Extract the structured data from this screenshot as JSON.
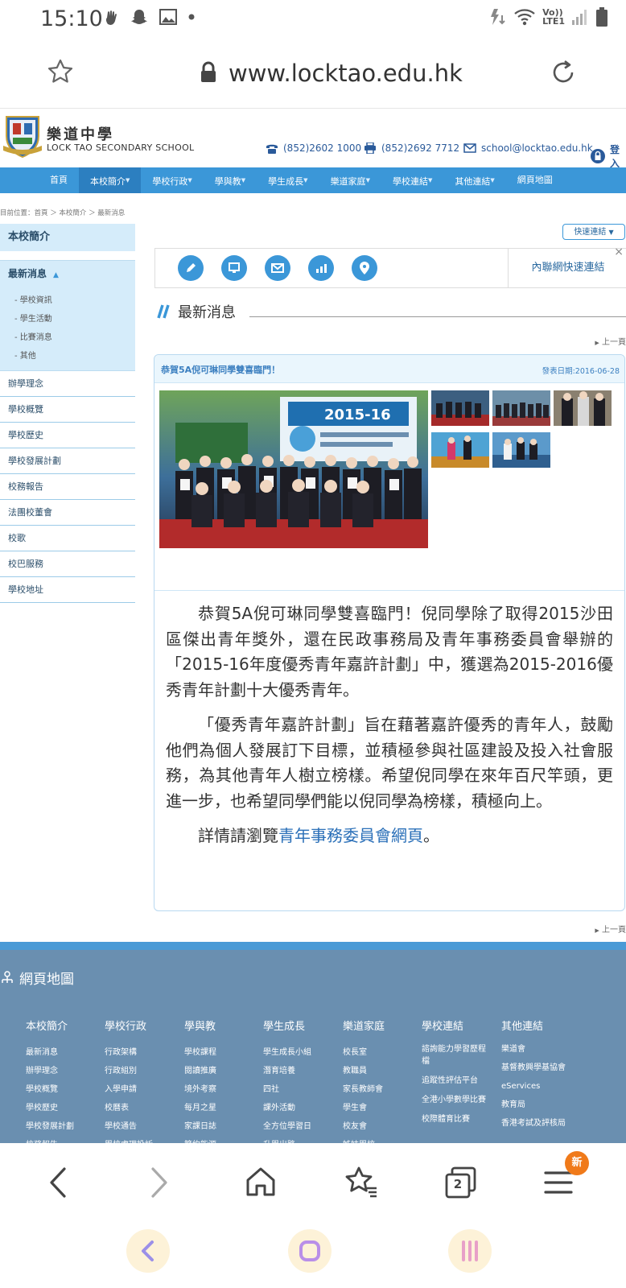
{
  "status": {
    "time": "15:10",
    "network": "LTE1",
    "volte": "Vo))"
  },
  "browser": {
    "url": "www.locktao.edu.hk"
  },
  "school": {
    "name_cn": "樂道中學",
    "name_en": "LOCK TAO SECONDARY SCHOOL",
    "phone": "(852)2602 1000",
    "fax": "(852)2692 7712",
    "email": "school@locktao.edu.hk",
    "login": "登入"
  },
  "nav": {
    "items": [
      {
        "label": "首頁"
      },
      {
        "label": "本校簡介"
      },
      {
        "label": "學校行政"
      },
      {
        "label": "學與教"
      },
      {
        "label": "學生成長"
      },
      {
        "label": "樂道家庭"
      },
      {
        "label": "學校連結"
      },
      {
        "label": "其他連結"
      },
      {
        "label": "網頁地圖"
      }
    ]
  },
  "breadcrumb": "目前位置：首頁 ＞ 本校簡介 ＞ 最新消息",
  "sidebar": {
    "title": "本校簡介",
    "current": "最新消息",
    "subitems": [
      "- 學校資訊",
      "- 學生活動",
      "- 比賽消息",
      "- 其他"
    ],
    "items": [
      "辦學理念",
      "學校概覽",
      "學校歷史",
      "學校發展計劃",
      "校務報告",
      "法團校董會",
      "校歌",
      "校巴服務",
      "學校地址"
    ]
  },
  "quick_link": "快速連結",
  "intranet": "內聯網快速連結",
  "section_title": "最新消息",
  "prev_page": "上一頁",
  "article": {
    "title": "恭賀5A倪可琳同學雙喜臨門！",
    "date": "發表日期:2016-06-28",
    "photo_banner": "2015-16",
    "p1": "恭賀5A倪可琳同學雙喜臨門！倪同學除了取得2015沙田區傑出青年獎外，還在民政事務局及青年事務委員會舉辦的「2015-16年度優秀青年嘉許計劃」中，獲選為2015-2016優秀青年計劃十大優秀青年。",
    "p2": "「優秀青年嘉許計劃」旨在藉著嘉許優秀的青年人，鼓勵他們為個人發展訂下目標，並積極參與社區建設及投入社會服務，為其他青年人樹立榜樣。希望倪同學在來年百尺竿頭，更進一步，也希望同學們能以倪同學為榜樣，積極向上。",
    "p3_prefix": "詳情請瀏覽",
    "p3_link": "青年事務委員會網頁",
    "p3_suffix": "。"
  },
  "footer": {
    "title": "網頁地圖",
    "columns": [
      {
        "head": "本校簡介",
        "links": [
          "最新消息",
          "辦學理念",
          "學校概覽",
          "學校歷史",
          "學校發展計劃",
          "校務報告"
        ]
      },
      {
        "head": "學校行政",
        "links": [
          "行政架構",
          "行政組別",
          "入學申請",
          "校曆表",
          "學校通告",
          "學校處理投訴"
        ]
      },
      {
        "head": "學與教",
        "links": [
          "學校課程",
          "閱讀推廣",
          "境外考察",
          "每月之星",
          "家課日誌",
          "節約能源"
        ]
      },
      {
        "head": "學生成長",
        "links": [
          "學生成長小組",
          "潛育培養",
          "四社",
          "課外活動",
          "全方位學習日",
          "升學出路"
        ]
      },
      {
        "head": "樂道家庭",
        "links": [
          "校長室",
          "教職員",
          "家長教師會",
          "學生會",
          "校友會",
          "姊妹學校"
        ]
      },
      {
        "head": "學校連結",
        "links": [
          "諮詢能力學習歷程檔",
          "追蹤性評估平台",
          "全港小學數學比賽",
          "校際體育比賽"
        ]
      },
      {
        "head": "其他連結",
        "links": [
          "樂道會",
          "基督教興學基協會",
          "eServices",
          "教育局",
          "香港考試及評核局"
        ]
      }
    ]
  },
  "bottom_nav": {
    "tabs_count": "2",
    "new_badge": "新"
  }
}
